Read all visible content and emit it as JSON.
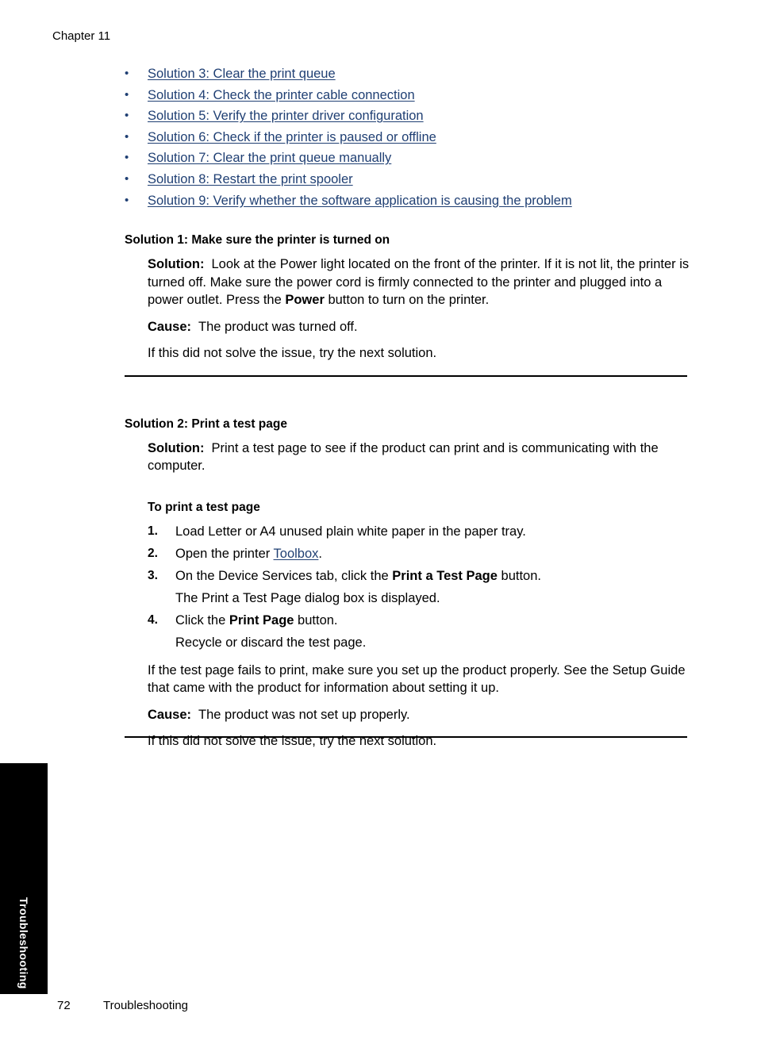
{
  "header": {
    "chapter": "Chapter 11"
  },
  "link_list": {
    "bullet_char": "•",
    "items": [
      {
        "label": "Solution 3: Clear the print queue"
      },
      {
        "label": "Solution 4: Check the printer cable connection"
      },
      {
        "label": "Solution 5: Verify the printer driver configuration"
      },
      {
        "label": "Solution 6: Check if the printer is paused or offline"
      },
      {
        "label": "Solution 7: Clear the print queue manually"
      },
      {
        "label": "Solution 8: Restart the print spooler"
      },
      {
        "label": "Solution 9: Verify whether the software application is causing the problem"
      }
    ]
  },
  "solution_1": {
    "heading": "Solution 1: Make sure the printer is turned on",
    "solution_label": "Solution:",
    "solution_text_1": "Look at the Power light located on the front of the printer. If it is not lit, the printer is turned off. Make sure the power cord is firmly connected to the printer and plugged into a power outlet. Press the ",
    "solution_bold": "Power",
    "solution_text_2": " button to turn on the printer.",
    "cause_label": "Cause:",
    "cause_text": "The product was turned off.",
    "next_text": "If this did not solve the issue, try the next solution."
  },
  "solution_2": {
    "heading": "Solution 2: Print a test page",
    "solution_label": "Solution:",
    "solution_text": "Print a test page to see if the product can print and is communicating with the computer.",
    "procedure_heading": "To print a test page",
    "steps": [
      {
        "num": "1.",
        "text_1": "Load Letter or A4 unused plain white paper in the paper tray.",
        "sub": ""
      },
      {
        "num": "2.",
        "text_1": "Open the printer ",
        "link": "Toolbox",
        "text_2": ".",
        "sub": ""
      },
      {
        "num": "3.",
        "text_1": "On the Device Services tab, click the ",
        "bold": "Print a Test Page",
        "text_2": " button.",
        "sub": "The Print a Test Page dialog box is displayed."
      },
      {
        "num": "4.",
        "text_1": "Click the ",
        "bold": "Print Page",
        "text_2": " button.",
        "sub": "Recycle or discard the test page."
      }
    ],
    "note_text": "If the test page fails to print, make sure you set up the product properly. See the Setup Guide that came with the product for information about setting it up.",
    "cause_label": "Cause:",
    "cause_text": "The product was not set up properly.",
    "next_text": "If this did not solve the issue, try the next solution."
  },
  "side_tab": {
    "label": "Troubleshooting"
  },
  "footer": {
    "page_number": "72",
    "section": "Troubleshooting"
  },
  "colors": {
    "link": "#1f3f73",
    "text": "#000000",
    "tab_background": "#000000",
    "tab_text": "#ffffff"
  }
}
